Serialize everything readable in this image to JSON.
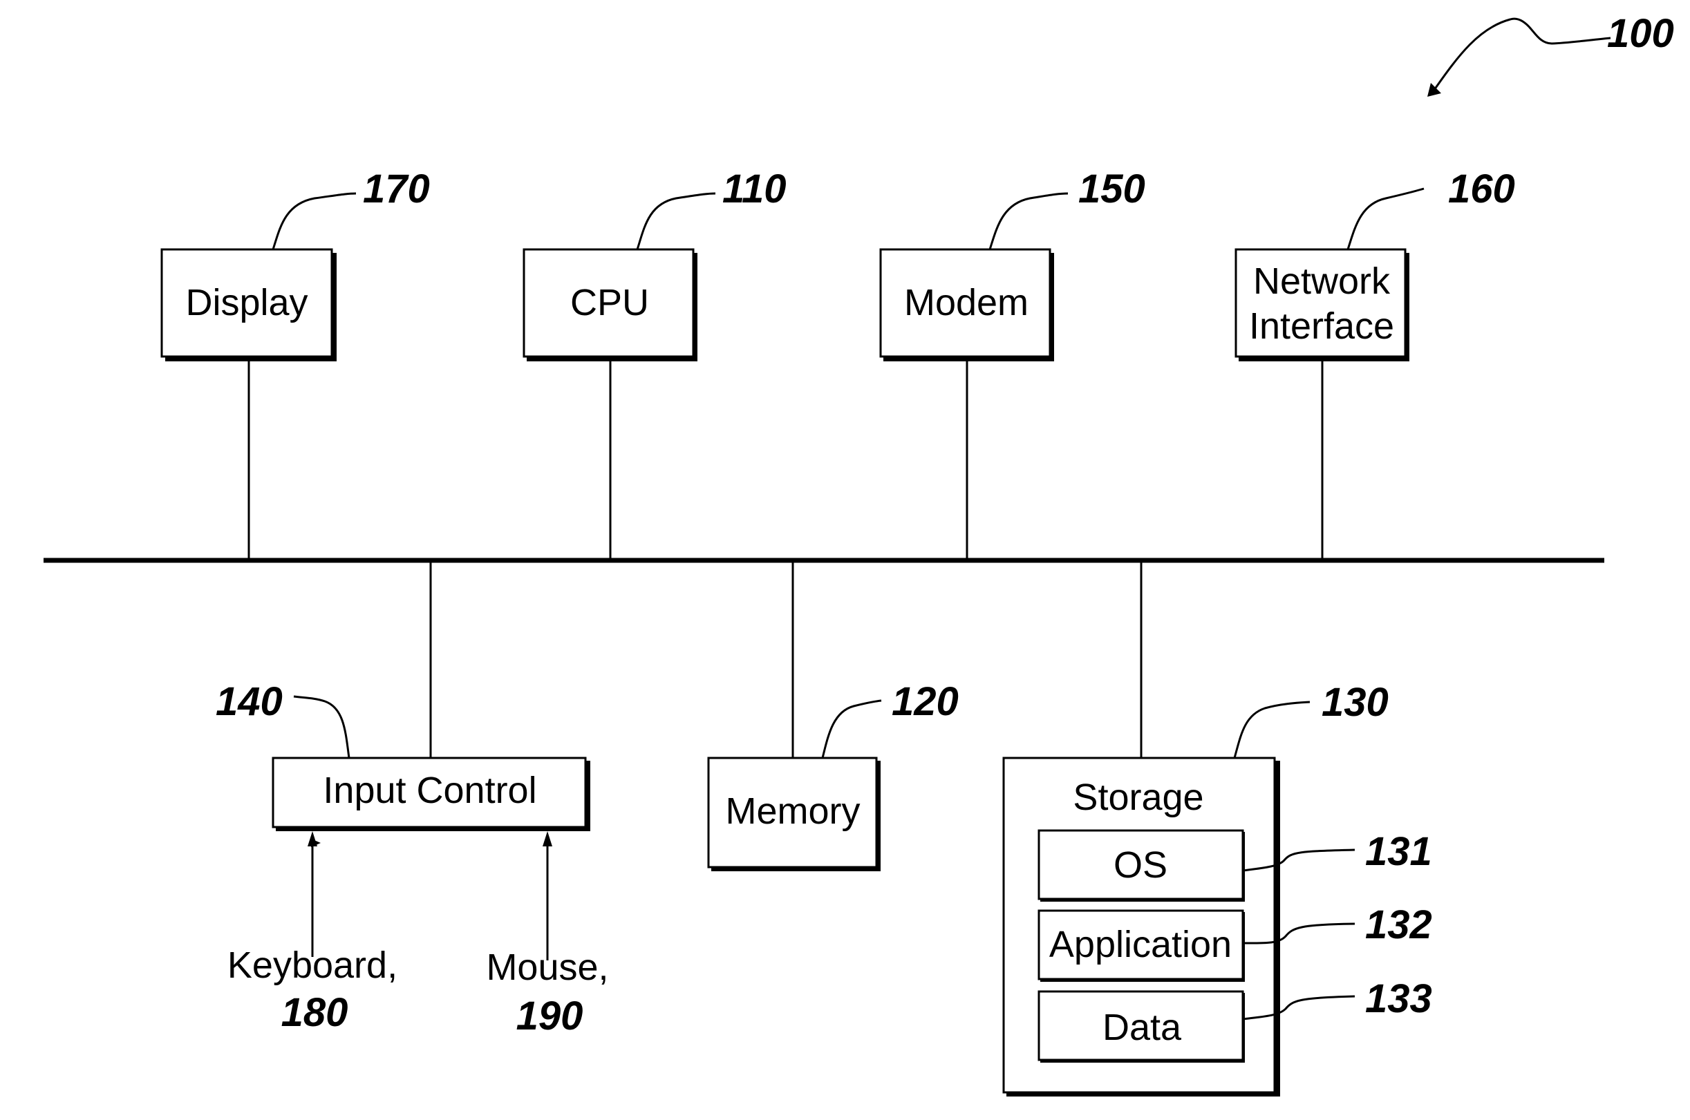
{
  "figure": {
    "ref": "100",
    "components": {
      "display": {
        "label": "Display",
        "ref": "170"
      },
      "cpu": {
        "label": "CPU",
        "ref": "110"
      },
      "modem": {
        "label": "Modem",
        "ref": "150"
      },
      "network": {
        "label_line1": "Network",
        "label_line2": "Interface",
        "ref": "160"
      },
      "input_control": {
        "label": "Input Control",
        "ref": "140"
      },
      "memory": {
        "label": "Memory",
        "ref": "120"
      },
      "storage": {
        "label": "Storage",
        "ref": "130",
        "os": {
          "label": "OS",
          "ref": "131"
        },
        "application": {
          "label": "Application",
          "ref": "132"
        },
        "data": {
          "label": "Data",
          "ref": "133"
        }
      },
      "keyboard": {
        "label": "Keyboard,",
        "ref": "180"
      },
      "mouse": {
        "label": "Mouse,",
        "ref": "190"
      }
    }
  }
}
